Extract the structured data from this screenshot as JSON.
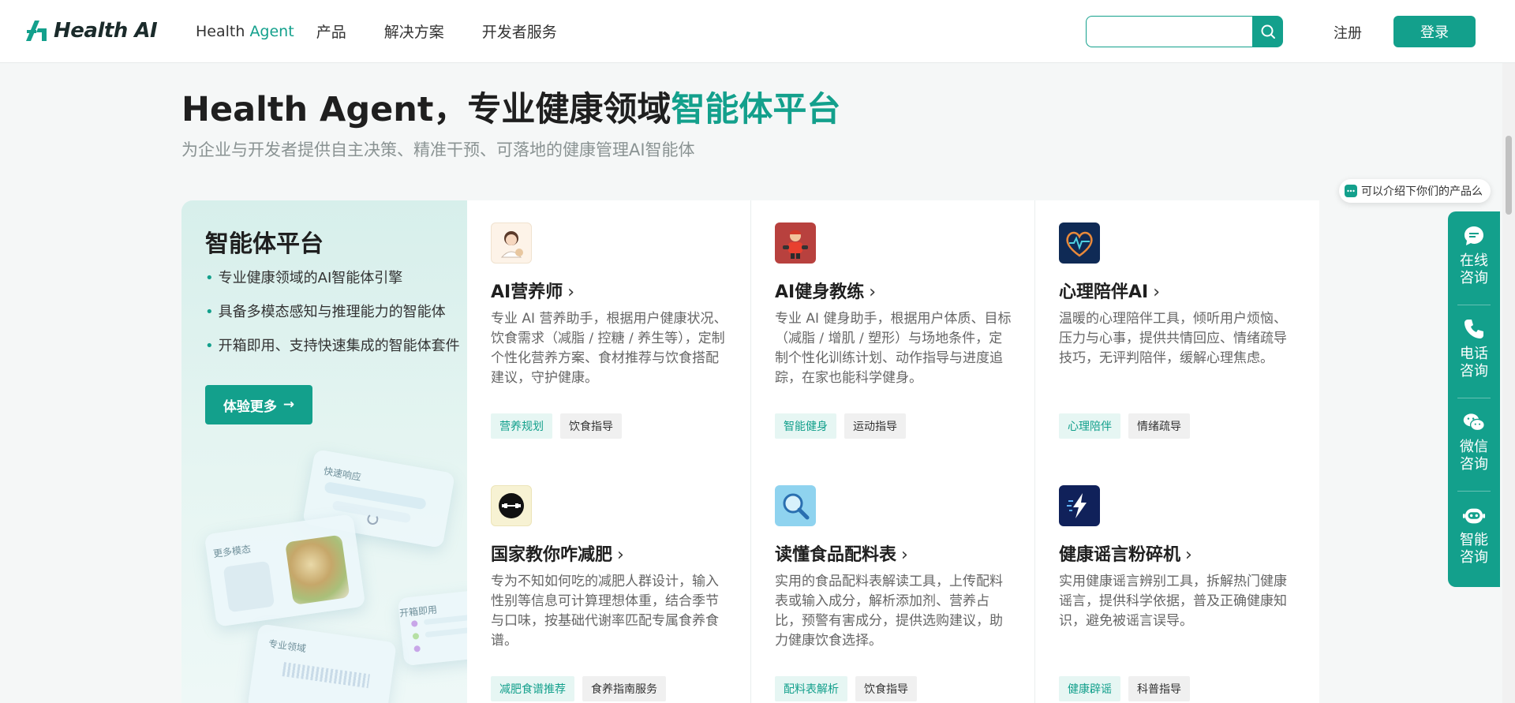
{
  "header": {
    "logo_text": "Health AI",
    "nav": [
      {
        "label_a": "Health",
        "label_b": "Agent"
      },
      {
        "label": "产品"
      },
      {
        "label": "解决方案"
      },
      {
        "label": "开发者服务"
      }
    ],
    "search": {
      "placeholder": ""
    },
    "register_label": "注册",
    "login_label": "登录"
  },
  "hero": {
    "title_a": "Health Agent，专业健康领域",
    "title_b": "智能体平台",
    "subtitle": "为企业与开发者提供自主决策、精准干预、可落地的健康管理AI智能体"
  },
  "panel": {
    "title": "智能体平台",
    "bullets": [
      "专业健康领域的AI智能体引擎",
      "具备多模态感知与推理能力的智能体",
      "开箱即用、支持快速集成的智能体套件"
    ],
    "button_label": "体验更多",
    "deco_tags": [
      "快速响应",
      "更多模态",
      "开箱即用",
      "专业领域"
    ]
  },
  "cards": [
    {
      "title": "AI营养师",
      "desc": "专业 AI 营养助手，根据用户健康状况、饮食需求（减脂 / 控糖 / 养生等），定制个性化营养方案、食材推荐与饮食搭配建议，守护健康。",
      "tags": [
        "营养规划",
        "饮食指导"
      ],
      "icon": "nutritionist-avatar-icon",
      "icon_bg": "#fdf3e8"
    },
    {
      "title": "AI健身教练",
      "desc": "专业 AI 健身助手，根据用户体质、目标（减脂 / 增肌 / 塑形）与场地条件，定制个性化训练计划、动作指导与进度追踪，在家也能科学健身。",
      "tags": [
        "智能健身",
        "运动指导"
      ],
      "icon": "fitness-coach-icon",
      "icon_bg": "#b8413e"
    },
    {
      "title": "心理陪伴AI",
      "desc": "温暖的心理陪伴工具，倾听用户烦恼、压力与心事，提供共情回应、情绪疏导技巧，无评判陪伴，缓解心理焦虑。",
      "tags": [
        "心理陪伴",
        "情绪疏导"
      ],
      "icon": "heart-icon",
      "icon_bg": "#0f2a55"
    },
    {
      "title": "国家教你咋减肥",
      "desc": "专为不知如何吃的减肥人群设计，输入性别等信息可计算理想体重，结合季节与口味，按基础代谢率匹配专属食养食谱。",
      "tags": [
        "减肥食谱推荐",
        "食养指南服务"
      ],
      "icon": "dumbbell-icon",
      "icon_bg": "#f7f2d3"
    },
    {
      "title": "读懂食品配料表",
      "desc": "实用的食品配料表解读工具，上传配料表或输入成分，解析添加剂、营养占比，预警有害成分，提供选购建议，助力健康饮食选择。",
      "tags": [
        "配料表解析",
        "饮食指导"
      ],
      "icon": "magnifier-icon",
      "icon_bg": "#8fd3ef"
    },
    {
      "title": "健康谣言粉碎机",
      "desc": "实用健康谣言辨别工具，拆解热门健康谣言，提供科学依据，普及正确健康知识，避免被谣言误导。",
      "tags": [
        "健康辟谣",
        "科普指导"
      ],
      "icon": "lightning-icon",
      "icon_bg": "#10215a"
    }
  ],
  "float": {
    "bubble_text": "可以介绍下你们的产品么",
    "side": [
      "在线咨询",
      "电话咨询",
      "微信咨询",
      "智能咨询"
    ]
  },
  "colors": {
    "accent": "#13a08c"
  }
}
